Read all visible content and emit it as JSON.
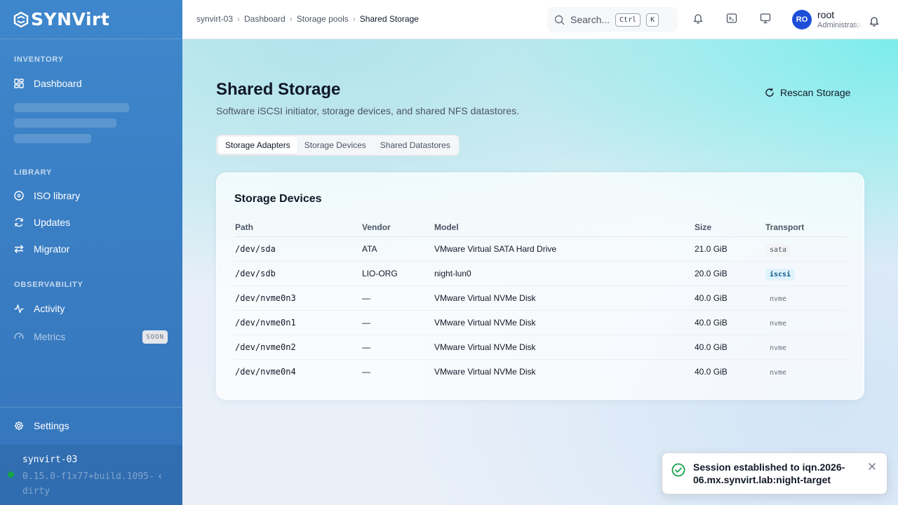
{
  "app": {
    "logo_text": "SYNVirt"
  },
  "sidebar": {
    "sections": {
      "inventory": "INVENTORY",
      "library": "LIBRARY",
      "observability": "OBSERVABILITY"
    },
    "items": {
      "dashboard": "Dashboard",
      "iso_library": "ISO library",
      "updates": "Updates",
      "migrator": "Migrator",
      "activity": "Activity",
      "metrics": "Metrics",
      "metrics_badge": "SOON",
      "settings": "Settings"
    },
    "host": {
      "name": "synvirt-03",
      "version": "0.15.0-f1x77+build.1095-dirty",
      "status_color": "#16a34a"
    }
  },
  "topbar": {
    "breadcrumb": [
      "synvirt-03",
      "Dashboard",
      "Storage pools",
      "Shared Storage"
    ],
    "search_placeholder": "Search...",
    "kbd_ctrl": "Ctrl",
    "kbd_k": "K",
    "user": {
      "initials": "RO",
      "name": "root",
      "role": "Administrator"
    }
  },
  "page": {
    "title": "Shared Storage",
    "subtitle": "Software iSCSI initiator, storage devices, and shared NFS datastores.",
    "rescan_label": "Rescan Storage",
    "tabs": [
      "Storage Adapters",
      "Storage Devices",
      "Shared Datastores"
    ],
    "active_tab": "Storage Adapters"
  },
  "devices": {
    "title": "Storage Devices",
    "columns": [
      "Path",
      "Vendor",
      "Model",
      "Size",
      "Transport"
    ],
    "rows": [
      {
        "path": "/dev/sda",
        "vendor": "ATA",
        "model": "VMware Virtual SATA Hard Drive",
        "size": "21.0 GiB",
        "transport": "sata"
      },
      {
        "path": "/dev/sdb",
        "vendor": "LIO-ORG",
        "model": "night-lun0",
        "size": "20.0 GiB",
        "transport": "iscsi"
      },
      {
        "path": "/dev/nvme0n3",
        "vendor": "—",
        "model": "VMware Virtual NVMe Disk",
        "size": "40.0 GiB",
        "transport": "nvme"
      },
      {
        "path": "/dev/nvme0n1",
        "vendor": "—",
        "model": "VMware Virtual NVMe Disk",
        "size": "40.0 GiB",
        "transport": "nvme"
      },
      {
        "path": "/dev/nvme0n2",
        "vendor": "—",
        "model": "VMware Virtual NVMe Disk",
        "size": "40.0 GiB",
        "transport": "nvme"
      },
      {
        "path": "/dev/nvme0n4",
        "vendor": "—",
        "model": "VMware Virtual NVMe Disk",
        "size": "40.0 GiB",
        "transport": "nvme"
      }
    ]
  },
  "toast": {
    "message": "Session established to iqn.2026-06.mx.synvirt.lab:night-target",
    "accent_color": "#16a34a"
  },
  "colors": {
    "sidebar": "#3a7ec4",
    "avatar": "#1d4ed8",
    "iscsi_pill": "#e0f2fe"
  }
}
